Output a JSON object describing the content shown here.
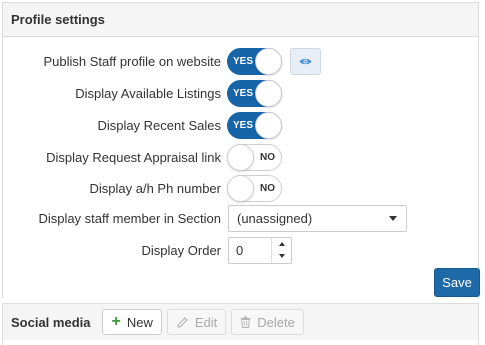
{
  "profile_panel": {
    "title": "Profile settings",
    "rows": [
      {
        "label": "Publish Staff profile on website",
        "toggle": "YES",
        "on": true
      },
      {
        "label": "Display Available Listings",
        "toggle": "YES",
        "on": true
      },
      {
        "label": "Display Recent Sales",
        "toggle": "YES",
        "on": true
      },
      {
        "label": "Display Request Appraisal link",
        "toggle": "NO",
        "on": false
      },
      {
        "label": "Display a/h Ph number",
        "toggle": "NO",
        "on": false
      }
    ],
    "section": {
      "label": "Display staff member in Section",
      "value": "(unassigned)"
    },
    "order": {
      "label": "Display Order",
      "value": "0"
    },
    "save_label": "Save",
    "preview_icon": "eye-icon"
  },
  "social_panel": {
    "title": "Social media",
    "new_label": "New",
    "edit_label": "Edit",
    "delete_label": "Delete"
  },
  "colors": {
    "accent": "#1565a8",
    "save_button": "#1e6aa8",
    "new_icon": "#3c9a3c",
    "eye_icon": "#4a90d9"
  }
}
